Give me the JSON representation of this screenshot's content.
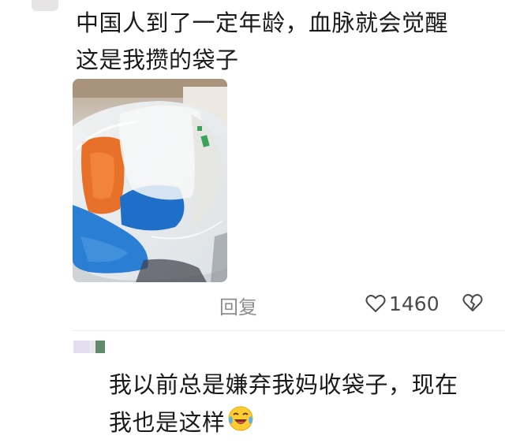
{
  "comment": {
    "text_line1": "中国人到了一定年龄，血脉就会觉醒",
    "text_line2": "这是我攒的袋子",
    "image_alt": "塑料袋"
  },
  "actions": {
    "reply_label": "回复",
    "like_count": "1460",
    "like_icon": "heart-outline-icon",
    "dislike_icon": "broken-heart-icon"
  },
  "reply": {
    "text_line1": "我以前总是嫌弃我妈收袋子，现在",
    "text_line2": "我也是这样",
    "emoji": "laughing-crying-emoji"
  },
  "colors": {
    "muted": "#8d8d8d",
    "divider": "#ececec",
    "avatar2_left": "#e3def0",
    "avatar2_right": "#5f8a6c"
  }
}
